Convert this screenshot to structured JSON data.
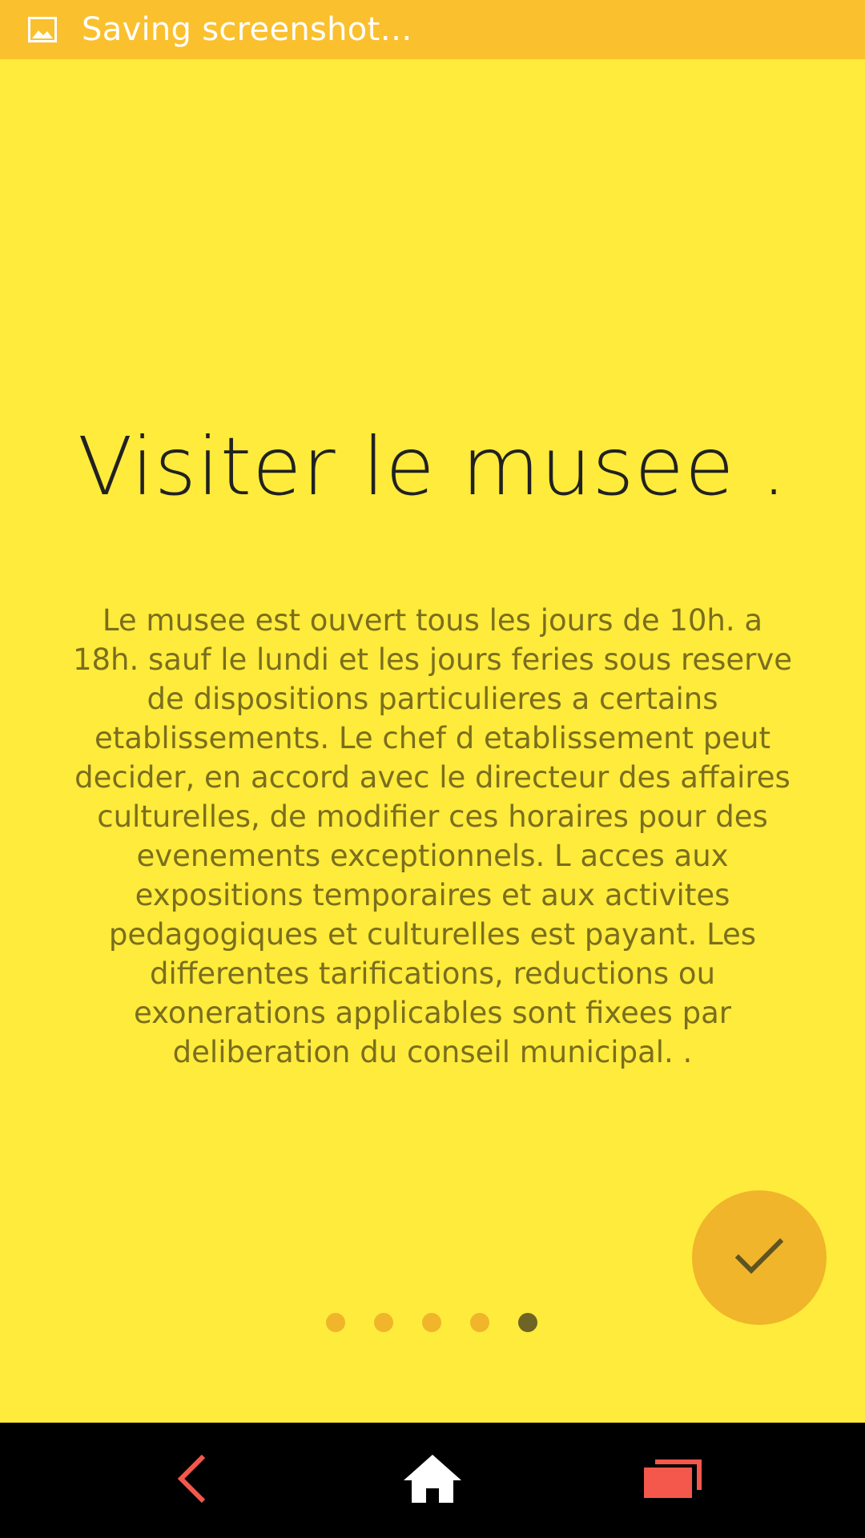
{
  "status_bar": {
    "icon": "image-icon",
    "text": "Saving screenshot…"
  },
  "slide": {
    "title": "Visiter le musee .",
    "body": "Le musee est ouvert tous les jours de 10h. a 18h. sauf le lundi et les jours feries sous reserve de dispositions particulieres a certains etablissements. Le chef d etablissement peut decider, en accord avec le directeur des affaires culturelles, de modifier ces horaires pour des evenements exceptionnels. L acces aux expositions temporaires et aux activites pedagogiques et culturelles est payant. Les differentes tarifications, reductions ou exonerations applicables sont fixees par deliberation du conseil municipal. ."
  },
  "pager": {
    "total": 5,
    "current": 5
  },
  "fab": {
    "icon": "checkmark-icon"
  },
  "nav_bar": {
    "back_icon": "back-icon",
    "home_icon": "home-icon",
    "recents_icon": "recents-icon"
  },
  "colors": {
    "background": "#FFEB3B",
    "status_bar": "#FBC02D",
    "accent": "#F0B52B",
    "dot_active": "#6E6424",
    "nav_icon_red": "#F4574B"
  }
}
